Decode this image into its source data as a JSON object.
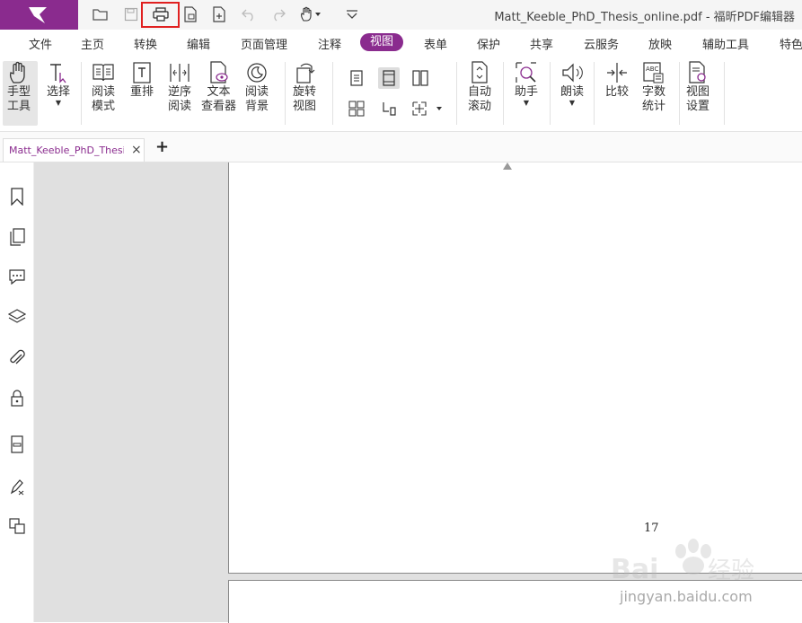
{
  "window": {
    "title": "Matt_Keeble_PhD_Thesis_online.pdf - 福昕PDF编辑器"
  },
  "quick_access": [
    {
      "name": "open-folder-icon"
    },
    {
      "name": "save-icon"
    },
    {
      "name": "print-icon",
      "highlighted": true
    },
    {
      "name": "export-icon"
    },
    {
      "name": "new-file-icon"
    },
    {
      "name": "undo-icon"
    },
    {
      "name": "redo-icon"
    },
    {
      "name": "hand-tool-dropdown-icon"
    },
    {
      "name": "customize-dropdown-icon"
    }
  ],
  "menu": {
    "items": [
      "文件",
      "主页",
      "转换",
      "编辑",
      "页面管理",
      "注释",
      "视图",
      "表单",
      "保护",
      "共享",
      "云服务",
      "放映",
      "辅助工具",
      "特色"
    ],
    "active": "视图"
  },
  "ribbon": {
    "hand_tool": [
      "手型",
      "工具"
    ],
    "select": "选择",
    "reading_mode": [
      "阅读",
      "模式"
    ],
    "reflow": "重排",
    "reverse_reading": [
      "逆序",
      "阅读"
    ],
    "text_viewer": [
      "文本",
      "查看器"
    ],
    "reading_background": [
      "阅读",
      "背景"
    ],
    "rotate_view": [
      "旋转",
      "视图"
    ],
    "auto_scroll": [
      "自动",
      "滚动"
    ],
    "assistant": "助手",
    "read_aloud": "朗读",
    "compare": "比较",
    "word_count": [
      "字数",
      "统计"
    ],
    "view_settings": [
      "视图",
      "设置"
    ]
  },
  "tabs": {
    "doc_title": "Matt_Keeble_PhD_Thesi...",
    "new_tab": "+",
    "close": "×"
  },
  "document": {
    "page_number": "17"
  },
  "watermark": {
    "logo_text": "Baidu经验",
    "url": "jingyan.baidu.com"
  },
  "colors": {
    "brand": "#8a2b8e",
    "highlight": "#e02020"
  }
}
